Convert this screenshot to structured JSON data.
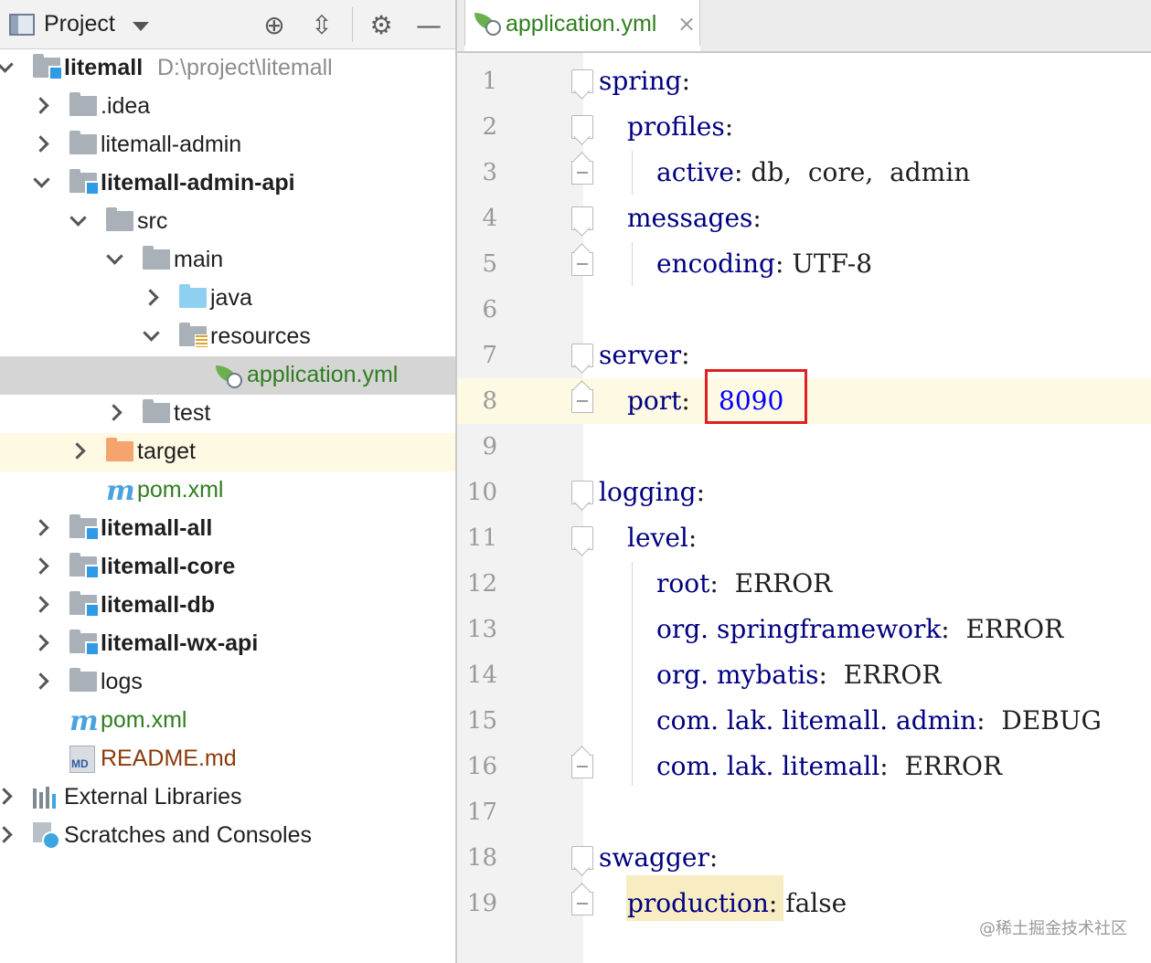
{
  "project_panel": {
    "title": "Project",
    "header_icons": [
      "project-view-icon",
      "chevron-down-icon",
      "locate-icon",
      "collapse-all-icon",
      "gear-icon",
      "hide-icon"
    ],
    "tree": [
      {
        "label": "litemall",
        "path": "D:\\project\\litemall",
        "icon": "module-folder-icon",
        "expanded": true
      },
      {
        "label": ".idea",
        "icon": "folder-icon",
        "expanded": false
      },
      {
        "label": "litemall-admin",
        "icon": "folder-icon",
        "expanded": false
      },
      {
        "label": "litemall-admin-api",
        "icon": "module-folder-icon",
        "expanded": true
      },
      {
        "label": "src",
        "icon": "folder-icon",
        "expanded": true
      },
      {
        "label": "main",
        "icon": "folder-icon",
        "expanded": true
      },
      {
        "label": "java",
        "icon": "source-folder-icon",
        "expanded": false
      },
      {
        "label": "resources",
        "icon": "resources-folder-icon",
        "expanded": true
      },
      {
        "label": "application.yml",
        "icon": "spring-config-icon",
        "selected": true
      },
      {
        "label": "test",
        "icon": "folder-icon",
        "expanded": false
      },
      {
        "label": "target",
        "icon": "excluded-folder-icon",
        "expanded": false
      },
      {
        "label": "pom.xml",
        "icon": "maven-icon"
      },
      {
        "label": "litemall-all",
        "icon": "module-folder-icon",
        "expanded": false
      },
      {
        "label": "litemall-core",
        "icon": "module-folder-icon",
        "expanded": false
      },
      {
        "label": "litemall-db",
        "icon": "module-folder-icon",
        "expanded": false
      },
      {
        "label": "litemall-wx-api",
        "icon": "module-folder-icon",
        "expanded": false
      },
      {
        "label": "logs",
        "icon": "folder-icon",
        "expanded": false
      },
      {
        "label": "pom.xml",
        "icon": "maven-icon"
      },
      {
        "label": "README.md",
        "icon": "markdown-icon"
      },
      {
        "label": "External Libraries",
        "icon": "libraries-icon",
        "expanded": false
      },
      {
        "label": "Scratches and Consoles",
        "icon": "scratches-icon",
        "expanded": false
      }
    ]
  },
  "editor": {
    "tab": {
      "label": "application.yml",
      "close_glyph": "×"
    },
    "lines": [
      {
        "n": "1",
        "key": "spring",
        "sep": ":",
        "value": ""
      },
      {
        "n": "2",
        "key": "profiles",
        "sep": ":",
        "value": ""
      },
      {
        "n": "3",
        "key": "active",
        "sep": ":",
        "value": " db,  core,  admin"
      },
      {
        "n": "4",
        "key": "messages",
        "sep": ":",
        "value": ""
      },
      {
        "n": "5",
        "key": "encoding",
        "sep": ":",
        "value": " UTF-8"
      },
      {
        "n": "6",
        "key": "",
        "sep": "",
        "value": ""
      },
      {
        "n": "7",
        "key": "server",
        "sep": ":",
        "value": ""
      },
      {
        "n": "8",
        "key": "port",
        "sep": ":",
        "value": "8090"
      },
      {
        "n": "9",
        "key": "",
        "sep": "",
        "value": ""
      },
      {
        "n": "10",
        "key": "logging",
        "sep": ":",
        "value": ""
      },
      {
        "n": "11",
        "key": "level",
        "sep": ":",
        "value": ""
      },
      {
        "n": "12",
        "key": "root",
        "sep": ":",
        "value": "  ERROR"
      },
      {
        "n": "13",
        "key": "org. springframework",
        "sep": ":",
        "value": "  ERROR"
      },
      {
        "n": "14",
        "key": "org. mybatis",
        "sep": ":",
        "value": "  ERROR"
      },
      {
        "n": "15",
        "key": "com. lak. litemall. admin",
        "sep": ":",
        "value": "  DEBUG"
      },
      {
        "n": "16",
        "key": "com. lak. litemall",
        "sep": ":",
        "value": "  ERROR"
      },
      {
        "n": "17",
        "key": "",
        "sep": "",
        "value": ""
      },
      {
        "n": "18",
        "key": "swagger",
        "sep": ":",
        "value": ""
      },
      {
        "n": "19",
        "key": "production",
        "sep": ":",
        "value": " false"
      }
    ]
  },
  "watermark": "@稀土掘金技术社区",
  "colors": {
    "key": "#000080",
    "number": "#0000ff",
    "highlight_box": "#e02020",
    "selected_row": "#d5d5d5",
    "current_line": "#fdf9e3"
  }
}
